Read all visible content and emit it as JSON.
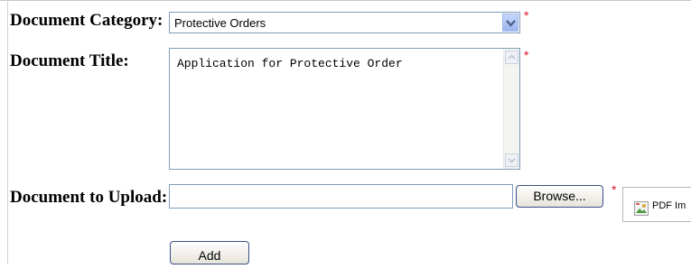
{
  "form": {
    "category": {
      "label": "Document Category:",
      "selected_value": "Protective Orders",
      "required_mark": "*"
    },
    "title": {
      "label": "Document Title:",
      "value": "Application for Protective Order",
      "required_mark": "*"
    },
    "upload": {
      "label": "Document to Upload:",
      "value": "",
      "browse_label": "Browse...",
      "required_mark": "*",
      "preview_text": "PDF Im"
    },
    "add_label": "Add"
  },
  "colors": {
    "required": "#e0122a",
    "input_border": "#7f9db9",
    "button_border": "#3b4f8a"
  }
}
